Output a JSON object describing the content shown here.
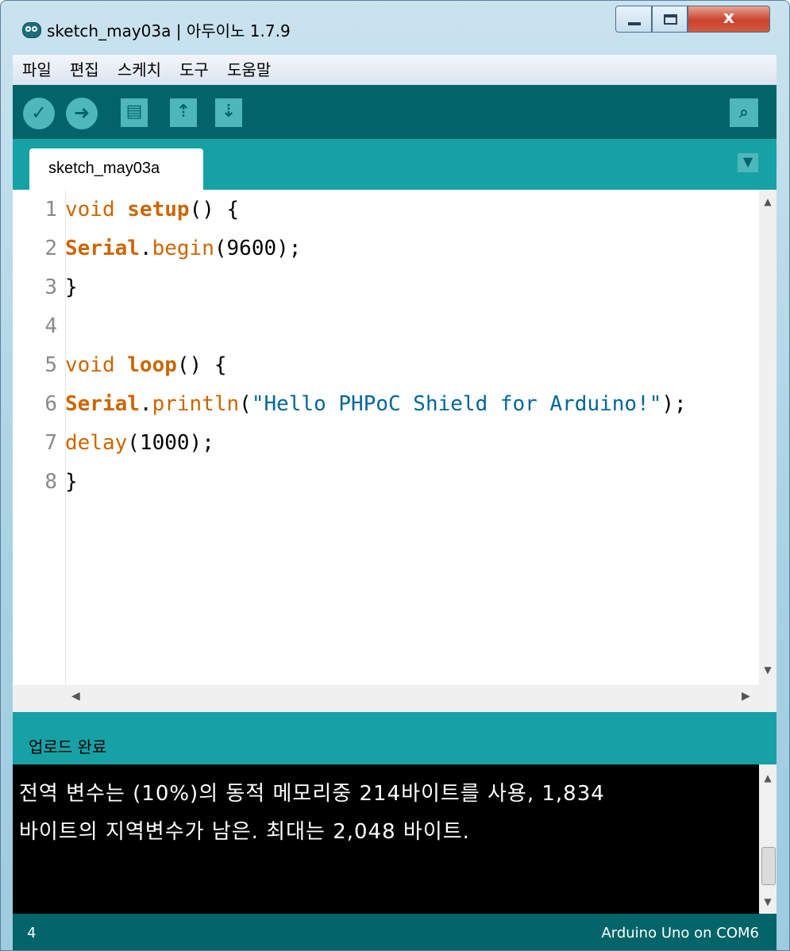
{
  "window": {
    "title": "sketch_may03a | 아두이노 1.7.9",
    "close_label": "x"
  },
  "menu": {
    "items": [
      "파일",
      "편집",
      "스케치",
      "도구",
      "도움말"
    ]
  },
  "toolbar": {
    "icons": [
      "verify-icon",
      "upload-icon",
      "new-icon",
      "open-icon",
      "save-icon",
      "serial-monitor-icon"
    ]
  },
  "tabs": {
    "active": "sketch_may03a"
  },
  "editor": {
    "line_numbers": [
      "1",
      "2",
      "3",
      "4",
      "5",
      "6",
      "7",
      "8"
    ],
    "lines": [
      [
        {
          "t": "void",
          "c": "kw"
        },
        {
          "t": " "
        },
        {
          "t": "setup",
          "c": "kwb"
        },
        {
          "t": "() {"
        }
      ],
      [
        {
          "t": "Serial",
          "c": "kwb"
        },
        {
          "t": "."
        },
        {
          "t": "begin",
          "c": "kw"
        },
        {
          "t": "(9600);"
        }
      ],
      [
        {
          "t": "}"
        }
      ],
      [
        {
          "t": ""
        }
      ],
      [
        {
          "t": "void",
          "c": "kw"
        },
        {
          "t": " "
        },
        {
          "t": "loop",
          "c": "kwb"
        },
        {
          "t": "() {"
        }
      ],
      [
        {
          "t": "Serial",
          "c": "kwb"
        },
        {
          "t": "."
        },
        {
          "t": "println",
          "c": "kw"
        },
        {
          "t": "("
        },
        {
          "t": "\"Hello PHPoC Shield for Arduino!\"",
          "c": "str"
        },
        {
          "t": ");"
        }
      ],
      [
        {
          "t": "delay",
          "c": "kw"
        },
        {
          "t": "(1000);"
        }
      ],
      [
        {
          "t": "}"
        }
      ]
    ]
  },
  "console": {
    "header": "업로드 완료",
    "lines": [
      "전역 변수는 (10%)의 동적 메모리중 214바이트를 사용, 1,834",
      "바이트의 지역변수가 남은. 최대는 2,048 바이트."
    ]
  },
  "status": {
    "line": "4",
    "board": "Arduino Uno on COM6"
  },
  "colors": {
    "toolbar_bg": "#006468",
    "tab_bar_bg": "#17a1a5",
    "button_fill": "#4db7bb",
    "keyword": "#cc6600",
    "string": "#006699"
  }
}
